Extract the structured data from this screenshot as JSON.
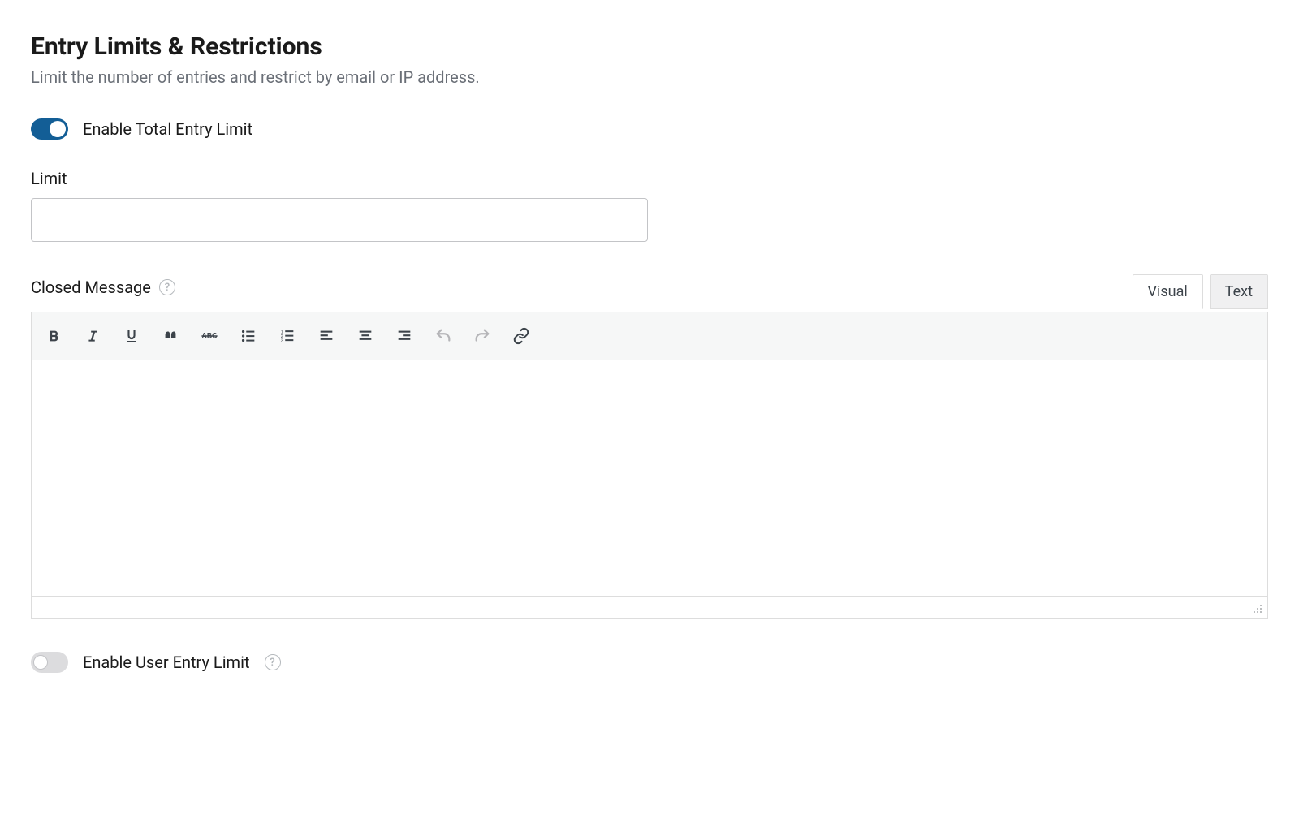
{
  "section": {
    "title": "Entry Limits & Restrictions",
    "subtitle": "Limit the number of entries and restrict by email or IP address."
  },
  "toggles": {
    "total": {
      "label": "Enable Total Entry Limit",
      "enabled": true
    },
    "user": {
      "label": "Enable User Entry Limit",
      "enabled": false
    }
  },
  "fields": {
    "limit": {
      "label": "Limit",
      "value": ""
    },
    "closed_message": {
      "label": "Closed Message",
      "value": ""
    }
  },
  "editor": {
    "tabs": {
      "visual": "Visual",
      "text": "Text",
      "active": "visual"
    },
    "toolbar": [
      {
        "name": "bold-icon",
        "label": "Bold"
      },
      {
        "name": "italic-icon",
        "label": "Italic"
      },
      {
        "name": "underline-icon",
        "label": "Underline"
      },
      {
        "name": "blockquote-icon",
        "label": "Blockquote"
      },
      {
        "name": "strikethrough-icon",
        "label": "Strikethrough"
      },
      {
        "name": "bulleted-list-icon",
        "label": "Bulleted list"
      },
      {
        "name": "numbered-list-icon",
        "label": "Numbered list"
      },
      {
        "name": "align-left-icon",
        "label": "Align left"
      },
      {
        "name": "align-center-icon",
        "label": "Align center"
      },
      {
        "name": "align-right-icon",
        "label": "Align right"
      },
      {
        "name": "undo-icon",
        "label": "Undo",
        "disabled": true
      },
      {
        "name": "redo-icon",
        "label": "Redo",
        "disabled": true
      },
      {
        "name": "link-icon",
        "label": "Insert link"
      }
    ]
  }
}
